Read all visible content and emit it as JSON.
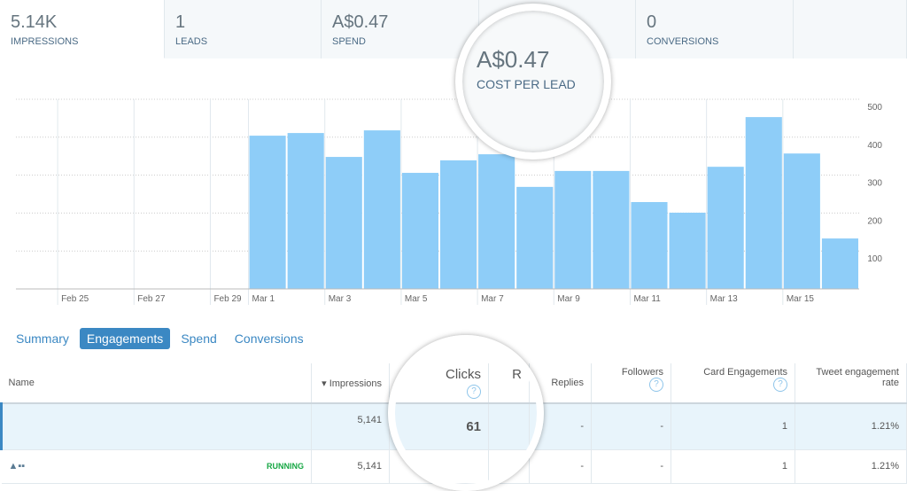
{
  "metrics": [
    {
      "value": "5.14K",
      "label": "IMPRESSIONS"
    },
    {
      "value": "1",
      "label": "LEADS"
    },
    {
      "value": "A$0.47",
      "label": "SPEND"
    },
    {
      "value": "A$0.47",
      "label": "COST PER LEAD"
    },
    {
      "value": "0",
      "label": "CONVERSIONS"
    }
  ],
  "subtabs": [
    "Summary",
    "Engagements",
    "Spend",
    "Conversions"
  ],
  "table": {
    "headers": [
      "Name",
      "Impressions",
      "Clicks",
      "R",
      "Replies",
      "Followers",
      "Card Engagements",
      "Tweet engagement rate"
    ],
    "rows": [
      {
        "name": "",
        "status": "",
        "impressions": "5,141",
        "clicks": "61",
        "r": "",
        "replies": "-",
        "followers": "-",
        "card": "1",
        "rate": "1.21%"
      },
      {
        "name": "",
        "status": "RUNNING",
        "impressions": "5,141",
        "clicks": "",
        "r": "-",
        "replies": "-",
        "followers": "-",
        "card": "1",
        "rate": "1.21%"
      }
    ]
  },
  "chart_data": {
    "type": "bar",
    "categories": [
      "Feb 24",
      "Feb 25",
      "Feb 26",
      "Feb 27",
      "Feb 28",
      "Feb 29",
      "Mar 1",
      "Mar 2",
      "Mar 3",
      "Mar 4",
      "Mar 5",
      "Mar 6",
      "Mar 7",
      "Mar 8",
      "Mar 9",
      "Mar 10",
      "Mar 11",
      "Mar 12",
      "Mar 13",
      "Mar 14",
      "Mar 15",
      "Mar 16"
    ],
    "values": [
      0,
      0,
      0,
      0,
      0,
      0,
      404,
      411,
      348,
      418,
      306,
      339,
      355,
      269,
      311,
      311,
      229,
      201,
      322,
      453,
      357,
      133
    ],
    "x_tick_labels": [
      "Feb 25",
      "Feb 27",
      "Feb 29",
      "Mar 1",
      "Mar 3",
      "Mar 5",
      "Mar 7",
      "Mar 9",
      "Mar 11",
      "Mar 13",
      "Mar 15"
    ],
    "y_ticks": [
      100,
      200,
      300,
      400,
      500
    ],
    "ylim": [
      0,
      500
    ],
    "grid": true,
    "bar_color": "#8ecdf8"
  }
}
